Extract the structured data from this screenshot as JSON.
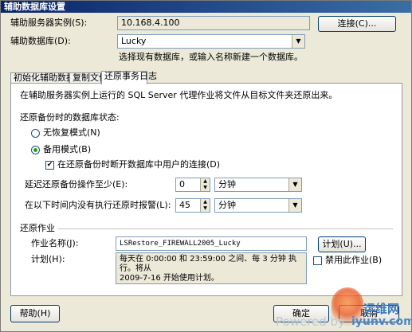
{
  "window": {
    "title": "辅助数据库设置"
  },
  "server": {
    "label": "辅助服务器实例(S):",
    "value": "10.168.4.100",
    "connect_button": "连接(C)..."
  },
  "database": {
    "label": "辅助数据库(D):",
    "value": "Lucky",
    "hint": "选择现有数据库，或输入名称新建一个数据库。"
  },
  "tabs": [
    {
      "label": "初始化辅助数据库"
    },
    {
      "label": "复制文件"
    },
    {
      "label": "还原事务日志"
    }
  ],
  "restore": {
    "description": "在辅助服务器实例上运行的 SQL Server 代理作业将文件从目标文件夹还原出来。",
    "state_label": "还原备份时的数据库状态:",
    "norecovery_label": "无恢复模式(N)",
    "standby_label": "备用模式(B)",
    "disconnect_label": "在还原备份时断开数据库中用户的连接(D)",
    "delay_label": "延迟还原备份操作至少(E):",
    "delay_value": "0",
    "delay_unit": "分钟",
    "alert_label": "在以下时间内没有执行还原时报警(L):",
    "alert_value": "45",
    "alert_unit": "分钟"
  },
  "job": {
    "section_label": "还原作业",
    "name_label": "作业名称(J):",
    "name_value": "LSRestore_FIREWALL2005_Lucky",
    "schedule_button": "计划(U)...",
    "schedule_label": "计划(H):",
    "schedule_text": "每天在 0:00:00 和 23:59:00 之间、每 3 分钟 执行。将从\n2009-7-16 开始使用计划。",
    "disable_label": "禁用此作业(B)"
  },
  "footer": {
    "help_button": "帮助(H)",
    "ok_button": "确定",
    "cancel_button": "取消"
  },
  "watermark": {
    "site_name": "运维网",
    "url": "iyunv.com",
    "powered": "Powered by"
  }
}
